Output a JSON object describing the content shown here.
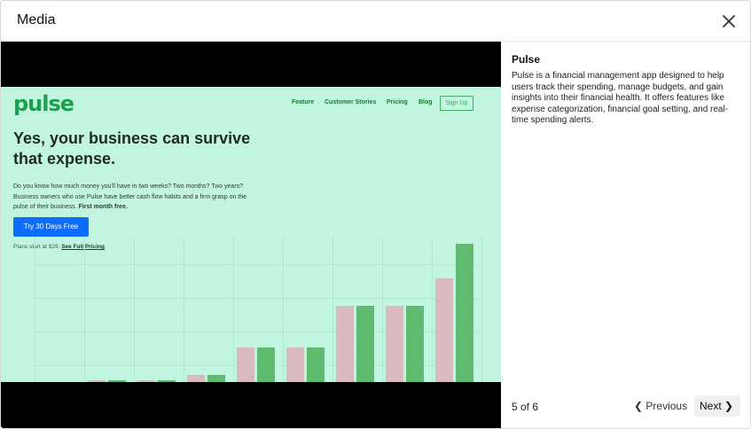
{
  "dialog": {
    "title": "Media",
    "close_icon": "close-icon"
  },
  "screenshot": {
    "logo": "pulse",
    "nav": [
      "Feature",
      "Customer Stories",
      "Pricing",
      "Blog"
    ],
    "signup": "Sign Up",
    "headline": "Yes, your business can survive that expense.",
    "body": "Do you know how much money you'll have in two weeks? Two months? Two years? Business owners who use Pulse have better cash flow habits and a firm grasp on the pulse of their business.",
    "body_bold": "First month free.",
    "cta": "Try 30 Days Free",
    "plans_text": "Plans start at $29.",
    "plans_link": "See Full Pricing",
    "colors": {
      "background": "#c1f5e0",
      "bar_pink": "#d9bbbf",
      "bar_green": "#5fbb70",
      "cta": "#0d6efd"
    },
    "bars": [
      {
        "pink": 0.01,
        "green": 0.01
      },
      {
        "pink": 0.01,
        "green": 0.01
      },
      {
        "pink": 0.05,
        "green": 0.05
      },
      {
        "pink": 0.25,
        "green": 0.25
      },
      {
        "pink": 0.25,
        "green": 0.25
      },
      {
        "pink": 0.55,
        "green": 0.55
      },
      {
        "pink": 0.55,
        "green": 0.55
      },
      {
        "pink": 0.75,
        "green": 1.0
      }
    ]
  },
  "details": {
    "title": "Pulse",
    "description": "Pulse is a financial management app designed to help users track their spending, manage budgets, and gain insights into their financial health. It offers features like expense categorization, financial goal setting, and real-time spending alerts."
  },
  "pager": {
    "counter": "5 of 6",
    "previous_label": "Previous",
    "next_label": "Next"
  }
}
